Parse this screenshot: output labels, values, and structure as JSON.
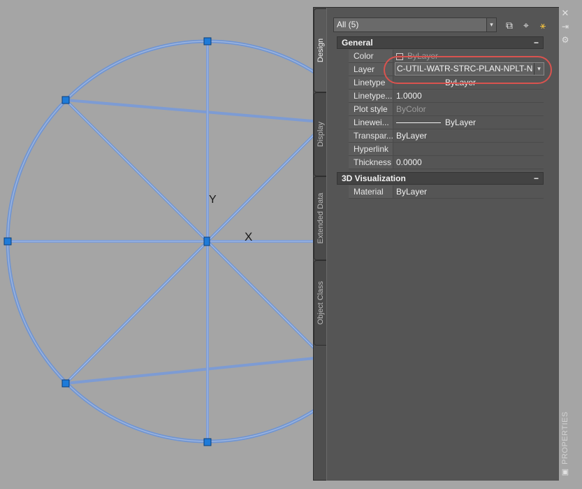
{
  "selection": {
    "value": "All (5)"
  },
  "toolbar": {
    "toggle_pickadd": "⧉",
    "select_objects": "⌖",
    "quick_select": "⚹"
  },
  "tabs": [
    "Design",
    "Display",
    "Extended Data",
    "Object Class"
  ],
  "sections": {
    "general": {
      "title": "General",
      "toggle": "−"
    },
    "viz": {
      "title": "3D Visualization",
      "toggle": "−"
    }
  },
  "general": {
    "color": {
      "label": "Color",
      "value": "ByLayer"
    },
    "layer": {
      "label": "Layer",
      "value": "C-UTIL-WATR-STRC-PLAN-NPLT-N"
    },
    "linetype": {
      "label": "Linetype",
      "value": "ByLayer"
    },
    "linetype_scale": {
      "label": "Linetype...",
      "value": "1.0000"
    },
    "plot_style": {
      "label": "Plot style",
      "value": "ByColor"
    },
    "lineweight": {
      "label": "Linewei...",
      "value": "ByLayer"
    },
    "transparency": {
      "label": "Transpar...",
      "value": "ByLayer"
    },
    "hyperlink": {
      "label": "Hyperlink",
      "value": ""
    },
    "thickness": {
      "label": "Thickness",
      "value": "0.0000"
    }
  },
  "viz": {
    "material": {
      "label": "Material",
      "value": "ByLayer"
    }
  },
  "palette": {
    "title": "PROPERTIES"
  },
  "drawing": {
    "ucs_x_label": "X",
    "ucs_y_label": "Y"
  },
  "colors": {
    "background": "#a5a5a5",
    "selected_geometry": "#6f95d4",
    "grip": "#1e7bd9",
    "highlight_ring": "#d9534f",
    "panel": "#555555"
  }
}
